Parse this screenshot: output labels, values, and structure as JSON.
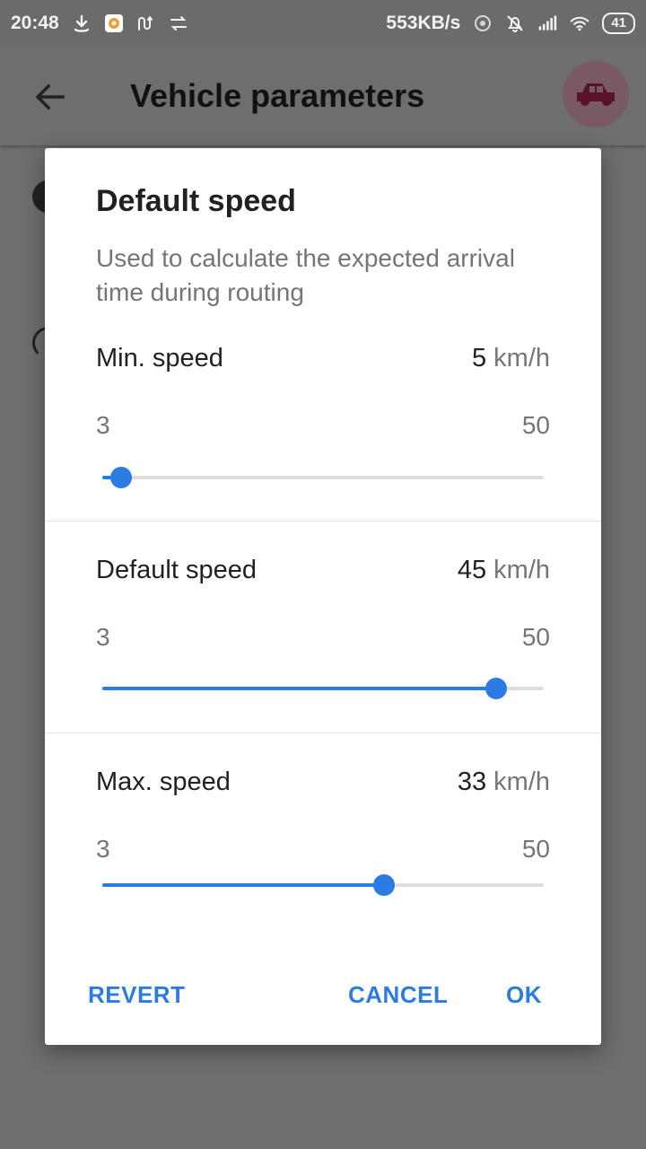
{
  "status_bar": {
    "time": "20:48",
    "network_speed": "553KB/s",
    "battery": "41"
  },
  "app_bar": {
    "title": "Vehicle parameters",
    "back_icon": "arrow-left-icon",
    "profile_icon": "car-icon"
  },
  "dialog": {
    "title": "Default speed",
    "description": "Used to calculate the expected arrival time during routing",
    "unit": "km/h",
    "sliders": [
      {
        "label": "Min. speed",
        "value": "5",
        "min": "3",
        "max": "50",
        "fraction": 0.043
      },
      {
        "label": "Default speed",
        "value": "45",
        "min": "3",
        "max": "50",
        "fraction": 0.893
      },
      {
        "label": "Max. speed",
        "value": "33",
        "min": "3",
        "max": "50",
        "fraction": 0.638
      }
    ],
    "buttons": {
      "revert": "REVERT",
      "cancel": "CANCEL",
      "ok": "OK"
    }
  },
  "colors": {
    "accent": "#2a7be4",
    "scrim": "#6e6e6e"
  }
}
